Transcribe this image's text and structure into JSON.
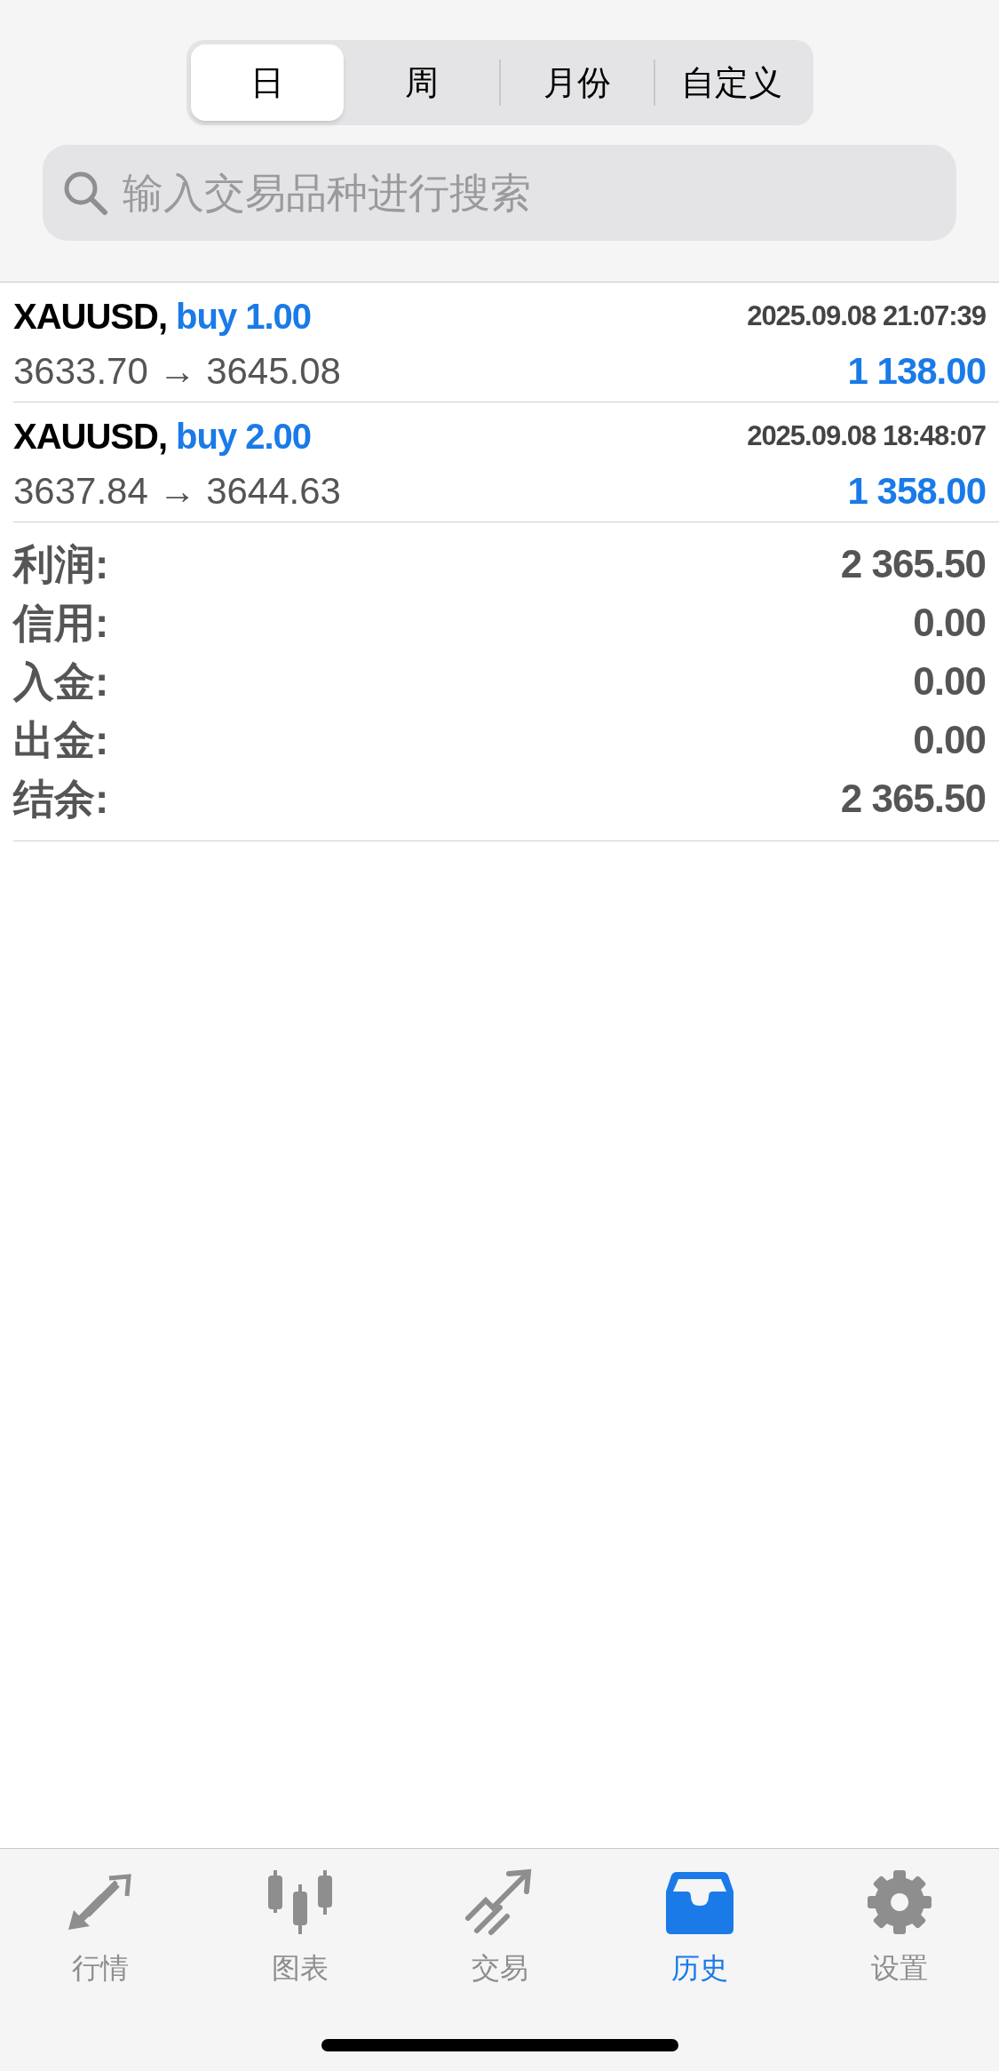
{
  "period_tabs": [
    {
      "label": "日",
      "selected": true
    },
    {
      "label": "周",
      "selected": false
    },
    {
      "label": "月份",
      "selected": false
    },
    {
      "label": "自定义",
      "selected": false
    }
  ],
  "search": {
    "placeholder": "输入交易品种进行搜索"
  },
  "trades": [
    {
      "symbol": "XAUUSD,",
      "side": "buy 1.00",
      "time": "2025.09.08 21:07:39",
      "prices": "3633.70 → 3645.08",
      "profit": "1 138.00"
    },
    {
      "symbol": "XAUUSD,",
      "side": "buy 2.00",
      "time": "2025.09.08 18:48:07",
      "prices": "3637.84 → 3644.63",
      "profit": "1 358.00"
    }
  ],
  "summary": [
    {
      "label": "利润:",
      "value": "2 365.50"
    },
    {
      "label": "信用:",
      "value": "0.00"
    },
    {
      "label": "入金:",
      "value": "0.00"
    },
    {
      "label": "出金:",
      "value": "0.00"
    },
    {
      "label": "结余:",
      "value": "2 365.50"
    }
  ],
  "tab_bar": [
    {
      "kind": "quotes",
      "label": "行情",
      "selected": false
    },
    {
      "kind": "chart",
      "label": "图表",
      "selected": false
    },
    {
      "kind": "trade",
      "label": "交易",
      "selected": false
    },
    {
      "kind": "history",
      "label": "历史",
      "selected": true
    },
    {
      "kind": "settings",
      "label": "设置",
      "selected": false
    }
  ]
}
